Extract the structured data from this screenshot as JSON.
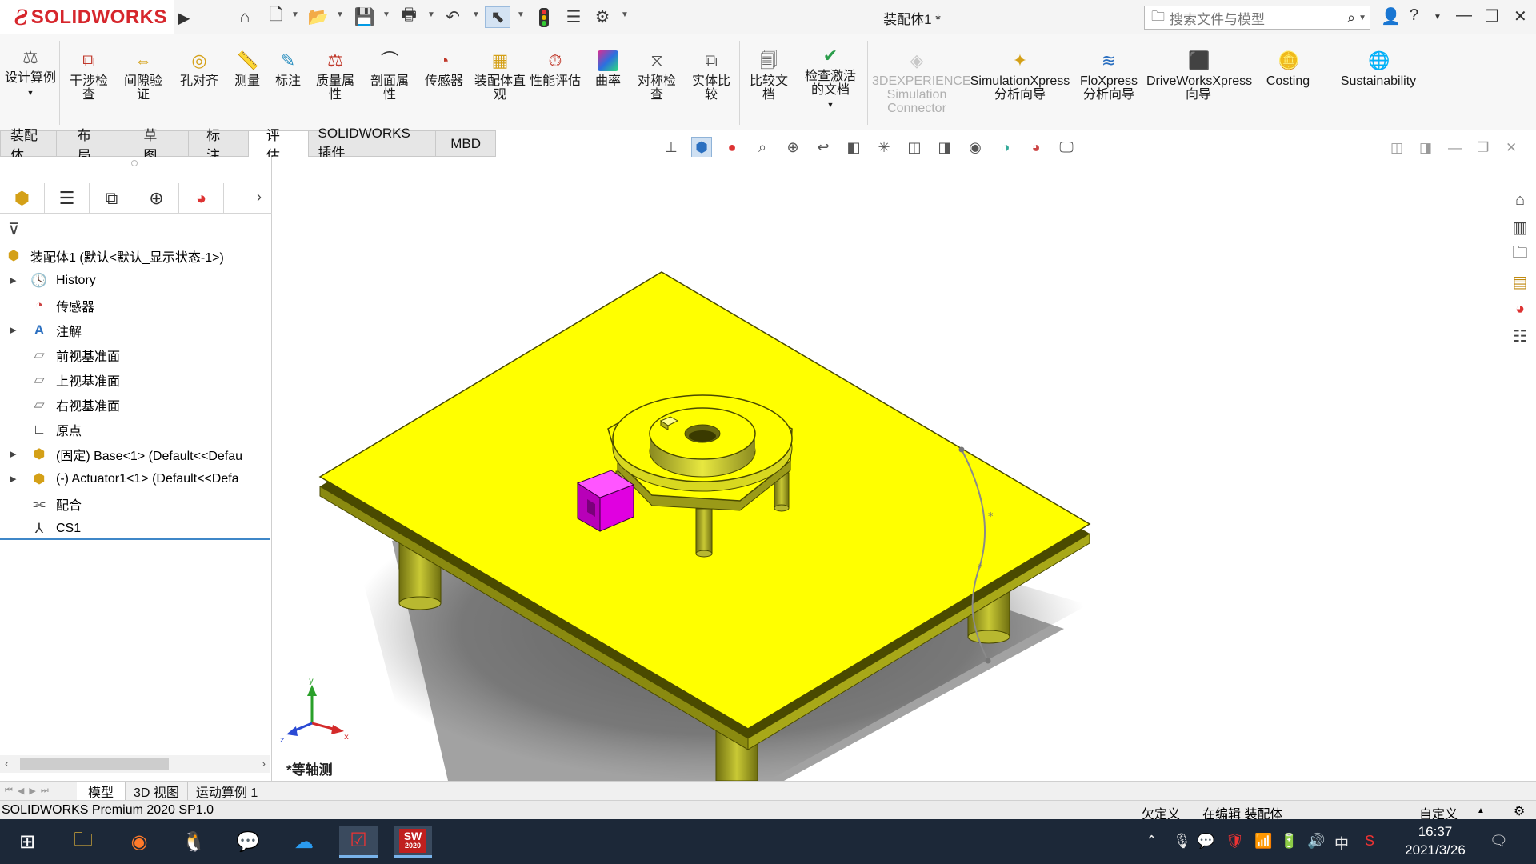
{
  "app": {
    "brand": "SOLIDWORKS",
    "doc_title": "装配体1 *"
  },
  "search": {
    "placeholder": "搜索文件与模型"
  },
  "ribbon": {
    "buttons": [
      {
        "label": "设计算例"
      },
      {
        "label": "干涉检查"
      },
      {
        "label": "间隙验证"
      },
      {
        "label": "孔对齐"
      },
      {
        "label": "测量"
      },
      {
        "label": "标注"
      },
      {
        "label": "质量属性"
      },
      {
        "label": "剖面属性"
      },
      {
        "label": "传感器"
      },
      {
        "label": "装配体直观"
      },
      {
        "label": "性能评估"
      },
      {
        "label": "曲率"
      },
      {
        "label": "对称检查"
      },
      {
        "label": "实体比较"
      },
      {
        "label": "比较文档"
      },
      {
        "label": "检查激活的文档"
      },
      {
        "label": "3DEXPERIENCE Simulation Connector"
      },
      {
        "label": "SimulationXpress 分析向导"
      },
      {
        "label": "FloXpress 分析向导"
      },
      {
        "label": "DriveWorksXpress 向导"
      },
      {
        "label": "Costing"
      },
      {
        "label": "Sustainability"
      }
    ]
  },
  "tabs": [
    {
      "label": "装配体"
    },
    {
      "label": "布局"
    },
    {
      "label": "草图"
    },
    {
      "label": "标注"
    },
    {
      "label": "评估"
    },
    {
      "label": "SOLIDWORKS 插件"
    },
    {
      "label": "MBD"
    }
  ],
  "tree": {
    "root": "装配体1 (默认<默认_显示状态-1>)",
    "items": [
      {
        "label": "History"
      },
      {
        "label": "传感器"
      },
      {
        "label": "注解"
      },
      {
        "label": "前视基准面"
      },
      {
        "label": "上视基准面"
      },
      {
        "label": "右视基准面"
      },
      {
        "label": "原点"
      },
      {
        "label": "(固定) Base<1> (Default<<Defau"
      },
      {
        "label": "(-) Actuator1<1> (Default<<Defa"
      },
      {
        "label": "配合"
      },
      {
        "label": "CS1"
      }
    ]
  },
  "viewport": {
    "view_name": "*等轴测",
    "colors": {
      "plate": "#ffff00",
      "actuator": "#e000e0",
      "edge": "#4a4a00"
    },
    "triad": {
      "x": "x",
      "y": "y",
      "z": "z"
    }
  },
  "bottom_tabs": [
    {
      "label": "模型"
    },
    {
      "label": "3D 视图"
    },
    {
      "label": "运动算例 1"
    }
  ],
  "status": {
    "version": "SOLIDWORKS Premium 2020 SP1.0",
    "defined": "欠定义",
    "editing": "在编辑 装配体",
    "custom": "自定义"
  },
  "taskbar": {
    "time": "16:37",
    "date": "2021/3/26",
    "ime": "中",
    "sw_badge": "2020"
  }
}
